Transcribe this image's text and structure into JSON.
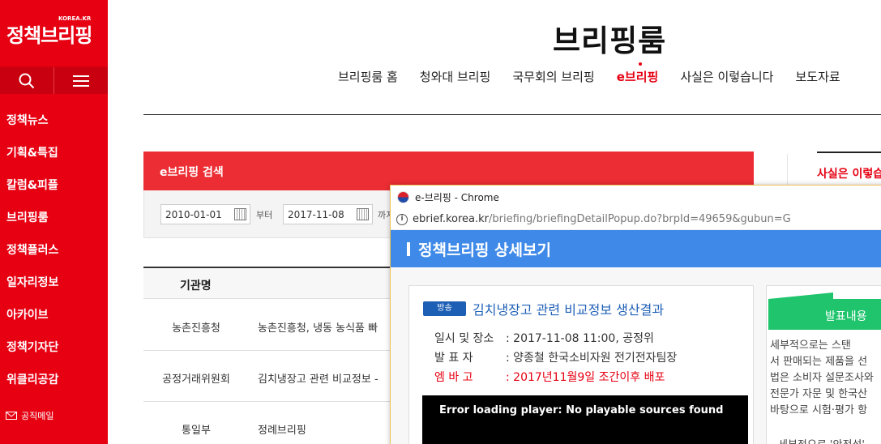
{
  "sidebar": {
    "logo_sup": "KOREA.KR",
    "logo": "정책브리핑",
    "menu": [
      "정책뉴스",
      "기획&특집",
      "칼럼&피플",
      "브리핑룸",
      "정책플러스",
      "일자리정보",
      "아카이브",
      "정책기자단",
      "위클리공감"
    ],
    "mail": "공직메일"
  },
  "header": {
    "title": "브리핑룸",
    "nav": [
      "브리핑룸 홈",
      "청와대 브리핑",
      "국무회의 브리핑",
      "e브리핑",
      "사실은 이렇습니다",
      "보도자료"
    ],
    "active_nav": "e브리핑"
  },
  "search": {
    "title": "e브리핑 검색",
    "from_date": "2010-01-01",
    "from_word": "부터",
    "to_date": "2017-11-08",
    "to_word": "까지"
  },
  "table": {
    "header": "기관명",
    "rows": [
      {
        "agency": "농촌진흥청",
        "title": "농촌진흥청, 냉동 농식품 빠"
      },
      {
        "agency": "공정거래위원회",
        "title": "김치냉장고 관련 비교정보 -"
      },
      {
        "agency": "통일부",
        "title": "정례브리핑"
      }
    ]
  },
  "right_panel": {
    "title": "사실은 이렇습"
  },
  "popup": {
    "window_title": "e-브리핑 - Chrome",
    "url_host": "ebrief.korea.kr",
    "url_path": "/briefing/briefingDetailPopup.do?brpId=49659&gubun=G",
    "header": "정책브리핑 상세보기",
    "badge": "방송",
    "title": "김치냉장고 관련 비교정보 생산결과",
    "info": [
      {
        "label": "일시 및 장소",
        "value": ": 2017-11-08 11:00, 공정위"
      },
      {
        "label": "발   표   자",
        "value": ": 양종철 한국소비자원 전기전자팀장"
      },
      {
        "label": "엠   바   고",
        "value": ": 2017년11월9일 조간이후 배포"
      }
    ],
    "video_error": "Error loading player: No playable sources found",
    "side_tab": "발표내용",
    "side_text": [
      "세부적으로는 스탠",
      "서 판매되는 제품을 선",
      "법은 소비자 설문조사와",
      "전문가 자문 및 한국산",
      "바탕으로 시험·평가 항"
    ],
    "side_foot": "세부적으로 '안전성'"
  }
}
